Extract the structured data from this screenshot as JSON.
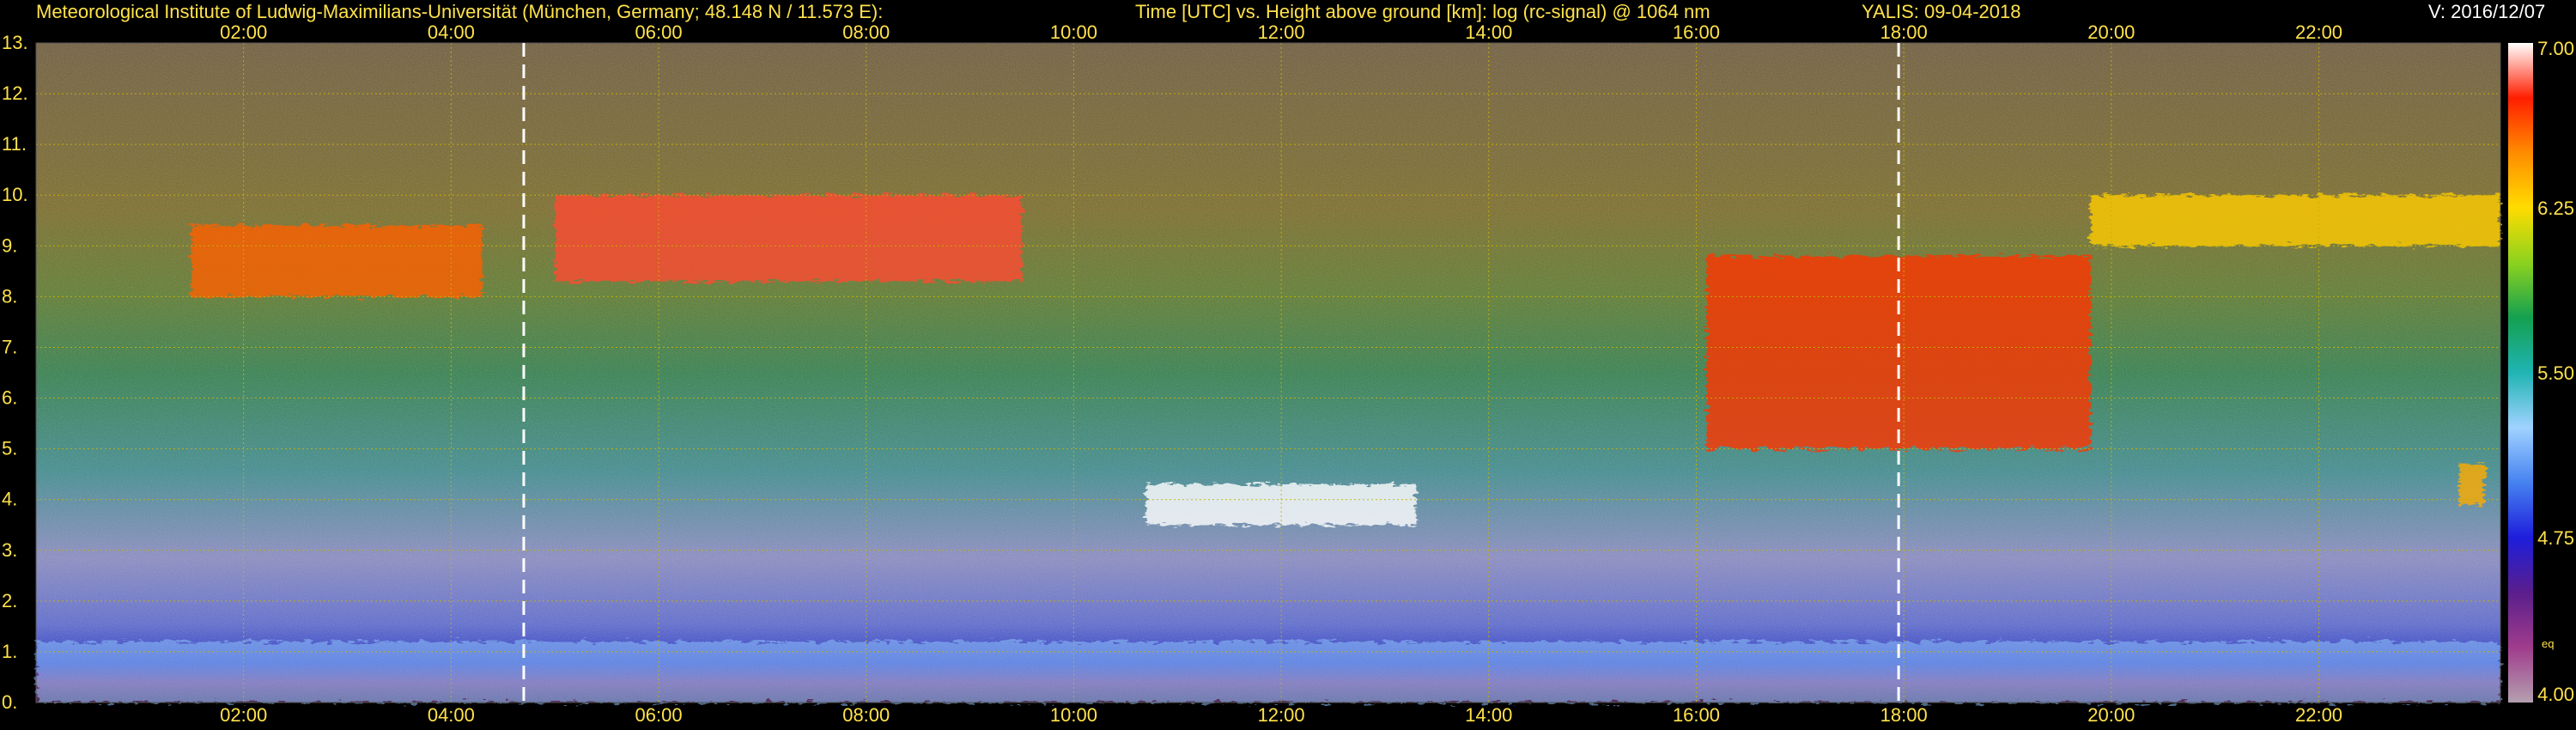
{
  "header": {
    "institute": "Meteorological Institute of Ludwig-Maximilians-Universität (München, Germany; 48.148 N / 11.573 E):",
    "description": "Time [UTC] vs. Height above ground [km]: log (rc-signal) @ 1064 nm",
    "instrument_date": "YALIS: 09-04-2018",
    "version": "V: 2016/12/07"
  },
  "colors": {
    "text": "#ffe24a",
    "grid": "#c8b400",
    "marker": "#ffffff",
    "background": "#000000"
  },
  "chart_data": {
    "type": "heatmap",
    "title": "",
    "xlabel": "",
    "ylabel": "",
    "x_unit": "hours UTC",
    "y_unit": "km",
    "xlim": [
      0.0,
      23.75
    ],
    "ylim": [
      0,
      13
    ],
    "x_ticks": [
      2,
      4,
      6,
      8,
      10,
      12,
      14,
      16,
      18,
      20,
      22
    ],
    "x_tick_labels": [
      "02:00",
      "04:00",
      "06:00",
      "08:00",
      "10:00",
      "12:00",
      "14:00",
      "16:00",
      "18:00",
      "20:00",
      "22:00"
    ],
    "y_ticks": [
      0,
      1,
      2,
      3,
      4,
      5,
      6,
      7,
      8,
      9,
      10,
      11,
      12,
      13
    ],
    "y_tick_labels": [
      "0.",
      "1.",
      "2.",
      "3.",
      "4.",
      "5.",
      "6.",
      "7.",
      "8.",
      "9.",
      "10.",
      "11.",
      "12.",
      "13."
    ],
    "grid": true,
    "vertical_markers_hours": [
      4.7,
      17.95
    ],
    "colorbar": {
      "range": [
        4.0,
        7.0
      ],
      "ticks": [
        4.0,
        4.75,
        5.5,
        6.25,
        7.0
      ],
      "tick_labels": [
        "4.00",
        "4.75",
        "5.50",
        "6.25",
        "7.00"
      ],
      "extra_label": "eq",
      "extra_label_value": 4.27,
      "placement": "right",
      "stops": [
        "#b4a0b0",
        "#a03c8c",
        "#5a1e8c",
        "#1e1edc",
        "#4682f0",
        "#a0d2ff",
        "#20b4b4",
        "#14a050",
        "#8cd21e",
        "#ffdc00",
        "#ff8c00",
        "#ff1e00",
        "#ffffff"
      ]
    },
    "layers": [
      {
        "name": "",
        "type": "boundary_layer",
        "x_start": 0.0,
        "x_end": 23.75,
        "y_bottom": 0.0,
        "y_top": 1.2,
        "intensity": 5.2
      },
      {
        "name": "",
        "type": "cirrus",
        "x_start": 1.5,
        "x_end": 4.3,
        "y_bottom": 8.0,
        "y_top": 9.4,
        "intensity": 6.6
      },
      {
        "name": "",
        "type": "cirrus",
        "x_start": 5.0,
        "x_end": 9.5,
        "y_bottom": 8.3,
        "y_top": 10.0,
        "intensity": 6.8
      },
      {
        "name": "",
        "type": "cloud",
        "x_start": 10.7,
        "x_end": 13.3,
        "y_bottom": 3.5,
        "y_top": 4.3,
        "intensity": 7.0
      },
      {
        "name": "",
        "type": "cirrus",
        "x_start": 16.1,
        "x_end": 19.8,
        "y_bottom": 5.0,
        "y_top": 8.8,
        "intensity": 6.7
      },
      {
        "name": "",
        "type": "cirrus",
        "x_start": 19.8,
        "x_end": 23.75,
        "y_bottom": 9.0,
        "y_top": 10.0,
        "intensity": 6.3
      },
      {
        "name": "",
        "type": "cloud",
        "x_start": 23.35,
        "x_end": 23.6,
        "y_bottom": 3.9,
        "y_top": 4.7,
        "intensity": 6.4
      }
    ]
  }
}
